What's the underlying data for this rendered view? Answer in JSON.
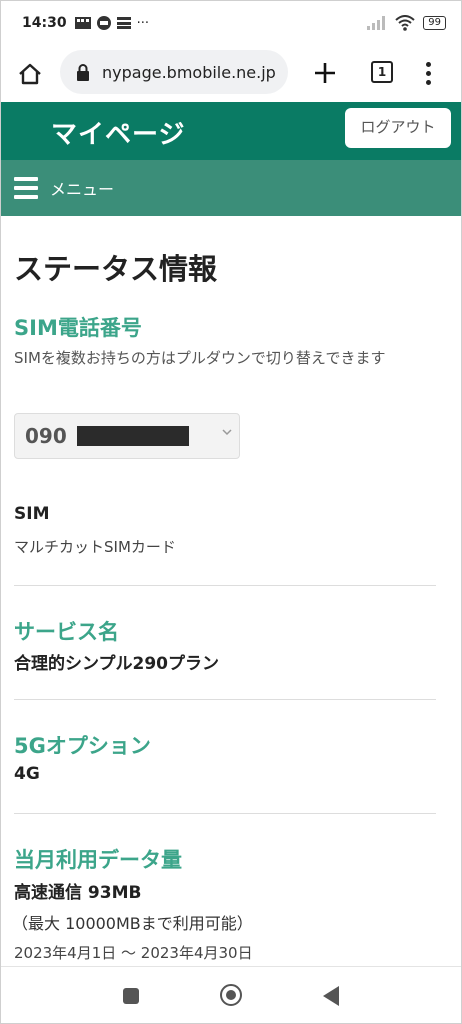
{
  "status_bar": {
    "time": "14:30",
    "notification_icons": [
      "grid-icon",
      "line-icon",
      "menu-icon"
    ],
    "more": "···",
    "battery": "99"
  },
  "browser": {
    "url": "nypage.bmobile.ne.jp",
    "tab_count": "1"
  },
  "header": {
    "title": "マイページ",
    "logout_label": "ログアウト"
  },
  "menu_bar": {
    "label": "メニュー"
  },
  "page": {
    "title": "ステータス情報",
    "sim_phone": {
      "heading": "SIM電話番号",
      "note": "SIMを複数お持ちの方はプルダウンで切り替えできます",
      "selected_prefix": "090"
    },
    "sim": {
      "label": "SIM",
      "value": "マルチカットSIMカード"
    },
    "service": {
      "heading": "サービス名",
      "value": "合理的シンプル290プラン"
    },
    "option_5g": {
      "heading": "5Gオプション",
      "value": "4G"
    },
    "data_usage": {
      "heading": "当月利用データ量",
      "value": "高速通信 93MB",
      "max": "（最大 10000MBまで利用可能）",
      "period": "2023年4月1日 ～ 2023年4月30日"
    }
  },
  "colors": {
    "header_green": "#0a7b64",
    "menu_green": "#3b8e79",
    "heading_green": "#3ca58a"
  }
}
